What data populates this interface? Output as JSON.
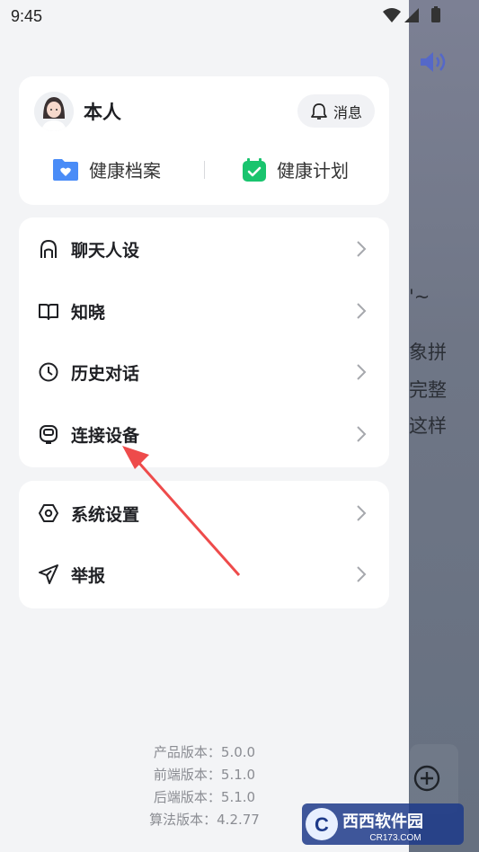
{
  "status_bar": {
    "time": "9:45"
  },
  "background": {
    "lines": [
      "'~",
      "象拼",
      "完整",
      "这样"
    ]
  },
  "profile": {
    "name": "本人",
    "message_label": "消息",
    "quick_links": [
      {
        "label": "健康档案",
        "icon": "health-record-icon",
        "color": "#4a8cf7"
      },
      {
        "label": "健康计划",
        "icon": "health-plan-icon",
        "color": "#19c46e"
      }
    ]
  },
  "menu1": [
    {
      "label": "聊天人设",
      "icon": "persona-icon"
    },
    {
      "label": "知晓",
      "icon": "book-icon"
    },
    {
      "label": "历史对话",
      "icon": "history-clock-icon"
    },
    {
      "label": "连接设备",
      "icon": "device-icon"
    }
  ],
  "menu2": [
    {
      "label": "系统设置",
      "icon": "settings-icon"
    },
    {
      "label": "举报",
      "icon": "report-send-icon"
    }
  ],
  "versions": {
    "product": "产品版本：5.0.0",
    "frontend": "前端版本：5.1.0",
    "backend": "后端版本：5.1.0",
    "algorithm": "算法版本：4.2.77"
  },
  "watermark": {
    "brand": "西西软件园",
    "site": "CR173.COM"
  },
  "colors": {
    "annotation_arrow": "#ee4b4b"
  }
}
